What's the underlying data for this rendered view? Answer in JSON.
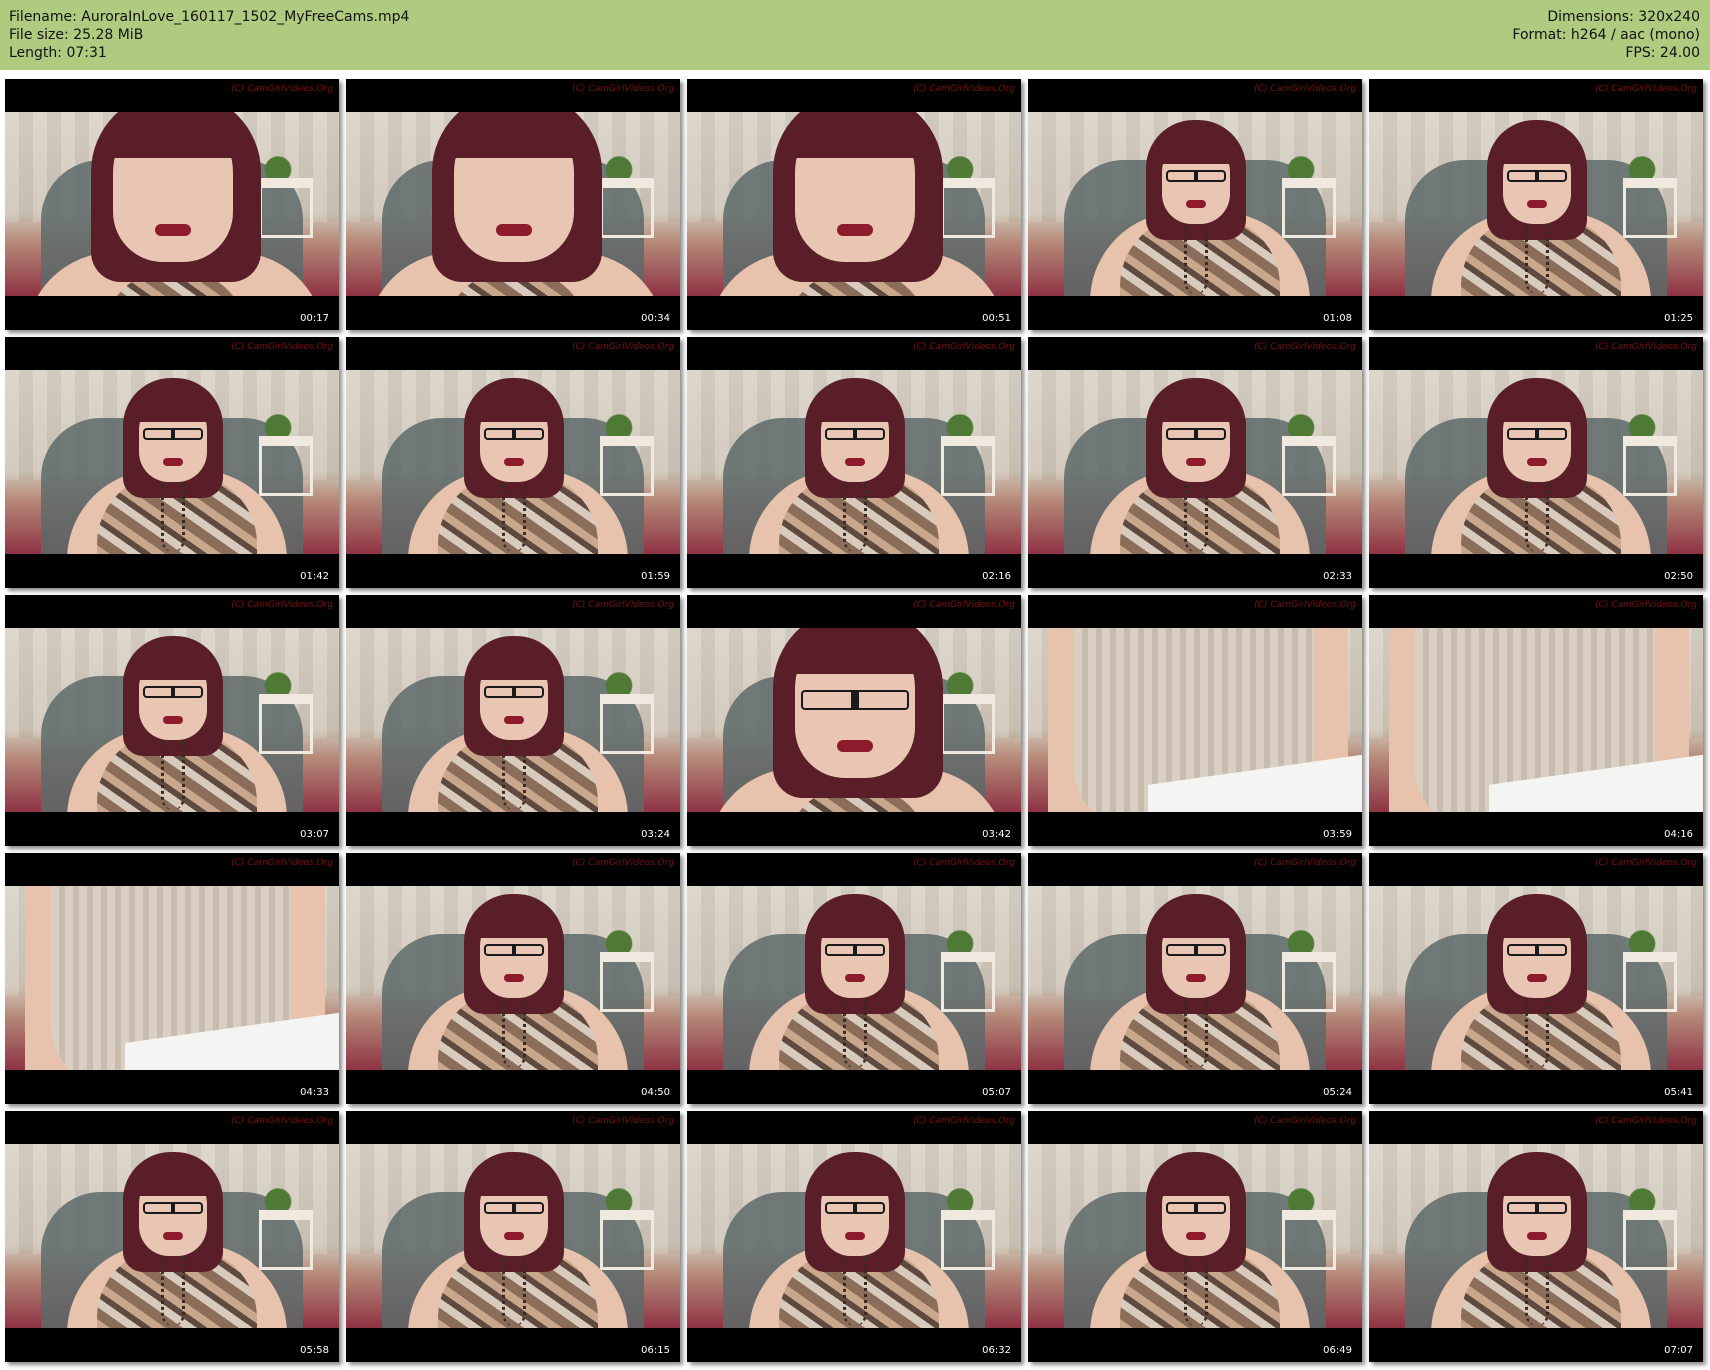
{
  "header": {
    "filename_line": "Filename: AuroraInLove_160117_1502_MyFreeCams.mp4",
    "filesize_line": "File size: 25.28 MiB",
    "length_line": "Length: 07:31",
    "dimensions_line": "Dimensions: 320x240",
    "format_line": "Format: h264 / aac (mono)",
    "fps_line": "FPS: 24.00"
  },
  "watermark": "(C) CamGirlVideos.Org",
  "thumbnails": [
    {
      "time": "00:17"
    },
    {
      "time": "00:34"
    },
    {
      "time": "00:51"
    },
    {
      "time": "01:08"
    },
    {
      "time": "01:25"
    },
    {
      "time": "01:42"
    },
    {
      "time": "01:59"
    },
    {
      "time": "02:16"
    },
    {
      "time": "02:33"
    },
    {
      "time": "02:50"
    },
    {
      "time": "03:07"
    },
    {
      "time": "03:24"
    },
    {
      "time": "03:42"
    },
    {
      "time": "03:59"
    },
    {
      "time": "04:16"
    },
    {
      "time": "04:33"
    },
    {
      "time": "04:50"
    },
    {
      "time": "05:07"
    },
    {
      "time": "05:24"
    },
    {
      "time": "05:41"
    },
    {
      "time": "05:58"
    },
    {
      "time": "06:15"
    },
    {
      "time": "06:32"
    },
    {
      "time": "06:49"
    },
    {
      "time": "07:07"
    }
  ],
  "colors": {
    "header_background": "#afcb80",
    "thumbnail_border": "#000000"
  }
}
